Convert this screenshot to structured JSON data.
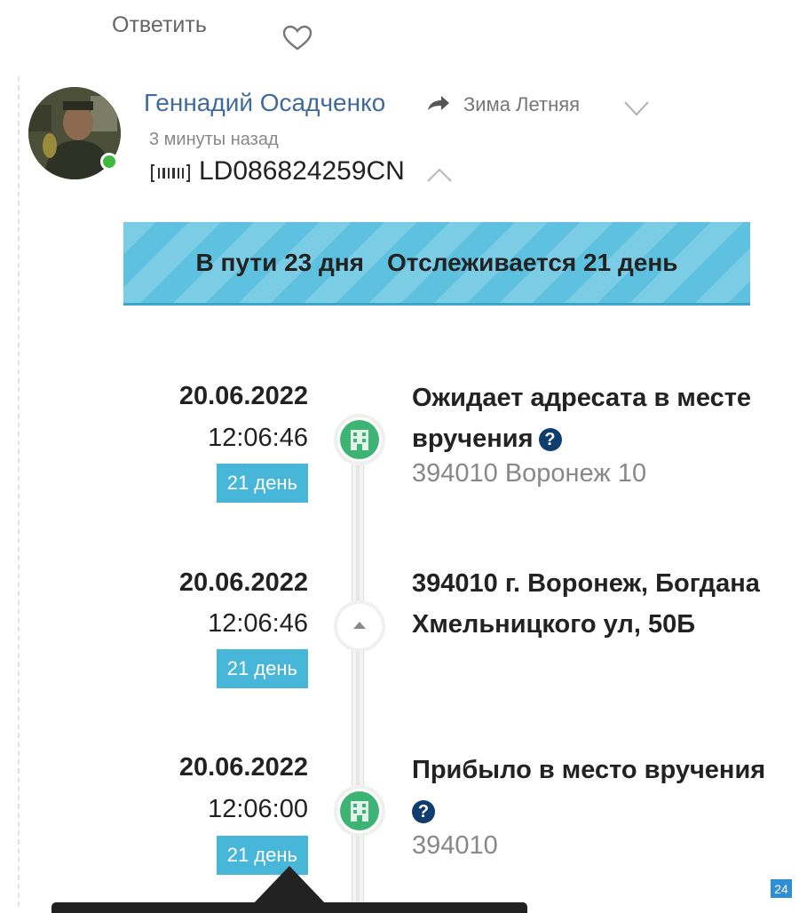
{
  "actions": {
    "reply_label": "Ответить"
  },
  "comment": {
    "author": "Геннадий Осадченко",
    "reply_to": "Зима Летняя",
    "time_ago": "3 минуты назад",
    "tracking_number": "LD086824259CN",
    "online_color": "#3dbb3d",
    "author_color": "#3f6a9a"
  },
  "banner": {
    "in_transit": "В пути 23 дня",
    "tracked": "Отслеживается 21 день",
    "color": "#5ec1df"
  },
  "events": [
    {
      "date": "20.06.2022",
      "time": "12:06:46",
      "day": "21 день",
      "title": "Ожидает адресата в месте вручения",
      "location": "394010 Воронеж 10",
      "icon": "post-office-icon"
    },
    {
      "date": "20.06.2022",
      "time": "12:06:46",
      "day": "21 день",
      "title": "394010 г. Воронеж, Богдана Хмельницкого ул, 50Б",
      "location": "",
      "icon": "collapse-arrow-icon"
    },
    {
      "date": "20.06.2022",
      "time": "12:06:00",
      "day": "21 день",
      "title": "Прибыло в место вручения",
      "location": "394010",
      "icon": "post-office-icon"
    }
  ],
  "corner_badge": "24"
}
